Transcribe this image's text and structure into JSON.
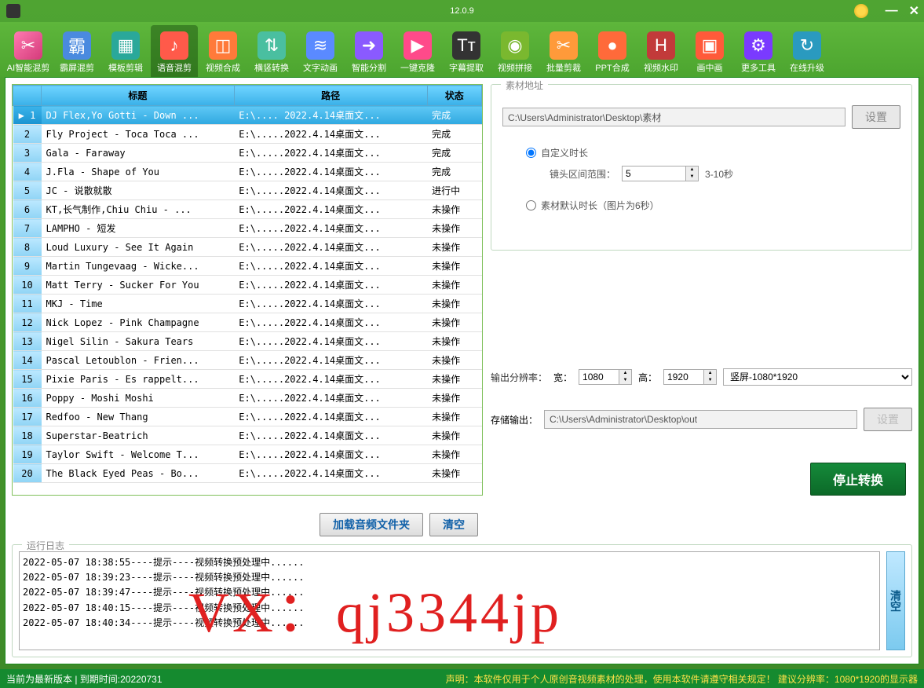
{
  "version": "12.0.9",
  "toolbar": [
    {
      "label": "AI智能混剪",
      "icon": "✂"
    },
    {
      "label": "霸屏混剪",
      "icon": "霸"
    },
    {
      "label": "模板剪辑",
      "icon": "▦"
    },
    {
      "label": "语音混剪",
      "icon": "♪",
      "active": true
    },
    {
      "label": "视频合成",
      "icon": "◫"
    },
    {
      "label": "横竖转换",
      "icon": "⇅"
    },
    {
      "label": "文字动画",
      "icon": "≋"
    },
    {
      "label": "智能分割",
      "icon": "➜"
    },
    {
      "label": "一键克隆",
      "icon": "▶"
    },
    {
      "label": "字幕提取",
      "icon": "Tᴛ"
    },
    {
      "label": "视频拼接",
      "icon": "◉"
    },
    {
      "label": "批量剪裁",
      "icon": "✂"
    },
    {
      "label": "PPT合成",
      "icon": "●"
    },
    {
      "label": "视频水印",
      "icon": "H"
    },
    {
      "label": "画中画",
      "icon": "▣"
    },
    {
      "label": "更多工具",
      "icon": "⚙"
    },
    {
      "label": "在线升级",
      "icon": "↻"
    }
  ],
  "grid": {
    "headers": {
      "title": "标题",
      "path": "路径",
      "status": "状态"
    },
    "rows": [
      {
        "n": 1,
        "title": "DJ Flex,Yo Gotti - Down ...",
        "path": "E:\\.... 2022.4.14桌面文...",
        "status": "完成",
        "sel": true
      },
      {
        "n": 2,
        "title": "Fly Project - Toca Toca ...",
        "path": "E:\\.....2022.4.14桌面文...",
        "status": "完成"
      },
      {
        "n": 3,
        "title": "Gala - Faraway",
        "path": "E:\\.....2022.4.14桌面文...",
        "status": "完成"
      },
      {
        "n": 4,
        "title": "J.Fla - Shape of You",
        "path": "E:\\.....2022.4.14桌面文...",
        "status": "完成"
      },
      {
        "n": 5,
        "title": "JC - 说散就散",
        "path": "E:\\.....2022.4.14桌面文...",
        "status": "进行中"
      },
      {
        "n": 6,
        "title": "KT,长气制作,Chiu Chiu - ...",
        "path": "E:\\.....2022.4.14桌面文...",
        "status": "未操作"
      },
      {
        "n": 7,
        "title": "LAMPHO - 短发",
        "path": "E:\\.....2022.4.14桌面文...",
        "status": "未操作"
      },
      {
        "n": 8,
        "title": "Loud Luxury - See It Again",
        "path": "E:\\.....2022.4.14桌面文...",
        "status": "未操作"
      },
      {
        "n": 9,
        "title": "Martin Tungevaag - Wicke...",
        "path": "E:\\.....2022.4.14桌面文...",
        "status": "未操作"
      },
      {
        "n": 10,
        "title": "Matt Terry - Sucker For You",
        "path": "E:\\.....2022.4.14桌面文...",
        "status": "未操作"
      },
      {
        "n": 11,
        "title": "MKJ - Time",
        "path": "E:\\.....2022.4.14桌面文...",
        "status": "未操作"
      },
      {
        "n": 12,
        "title": "Nick Lopez - Pink Champagne",
        "path": "E:\\.....2022.4.14桌面文...",
        "status": "未操作"
      },
      {
        "n": 13,
        "title": "Nigel Silin - Sakura Tears",
        "path": "E:\\.....2022.4.14桌面文...",
        "status": "未操作"
      },
      {
        "n": 14,
        "title": "Pascal Letoublon - Frien...",
        "path": "E:\\.....2022.4.14桌面文...",
        "status": "未操作"
      },
      {
        "n": 15,
        "title": "Pixie Paris - Es rappelt...",
        "path": "E:\\.....2022.4.14桌面文...",
        "status": "未操作"
      },
      {
        "n": 16,
        "title": "Poppy - Moshi Moshi",
        "path": "E:\\.....2022.4.14桌面文...",
        "status": "未操作"
      },
      {
        "n": 17,
        "title": "Redfoo - New Thang",
        "path": "E:\\.....2022.4.14桌面文...",
        "status": "未操作"
      },
      {
        "n": 18,
        "title": "Superstar-Beatrich",
        "path": "E:\\.....2022.4.14桌面文...",
        "status": "未操作"
      },
      {
        "n": 19,
        "title": "Taylor Swift - Welcome T...",
        "path": "E:\\.....2022.4.14桌面文...",
        "status": "未操作"
      },
      {
        "n": 20,
        "title": "The Black Eyed Peas - Bo...",
        "path": "E:\\.....2022.4.14桌面文...",
        "status": "未操作"
      }
    ]
  },
  "leftbtns": {
    "load": "加载音频文件夹",
    "clear": "清空"
  },
  "material": {
    "legend": "素材地址",
    "path": "C:\\Users\\Administrator\\Desktop\\素材",
    "set_btn": "设置",
    "radio_custom": "自定义时长",
    "range_label": "镜头区间范围：",
    "range_value": "5",
    "range_hint": "3-10秒",
    "radio_default": "素材默认时长（图片为6秒）"
  },
  "output": {
    "res_label": "输出分辨率：",
    "w_label": "宽：",
    "w_value": "1080",
    "h_label": "高：",
    "h_value": "1920",
    "preset": "竖屏-1080*1920",
    "store_label": "存储输出：",
    "store_path": "C:\\Users\\Administrator\\Desktop\\out",
    "set_btn": "设置"
  },
  "stop_btn": "停止转换",
  "log": {
    "legend": "运行日志",
    "lines": [
      "2022-05-07 18:38:55----提示----视频转换预处理中......",
      "2022-05-07 18:39:23----提示----视频转换预处理中......",
      "2022-05-07 18:39:47----提示----视频转换预处理中......",
      "2022-05-07 18:40:15----提示----视频转换预处理中......",
      "2022-05-07 18:40:34----提示----视频转换预处理中......"
    ],
    "clear": "清空"
  },
  "watermark": "VX：qj3344jp",
  "status": {
    "left": "当前为最新版本 | 到期时间:20220731",
    "right": "声明：本软件仅用于个人原创音视频素材的处理，使用本软件请遵守相关规定！ 建议分辨率：1080*1920的显示器"
  }
}
